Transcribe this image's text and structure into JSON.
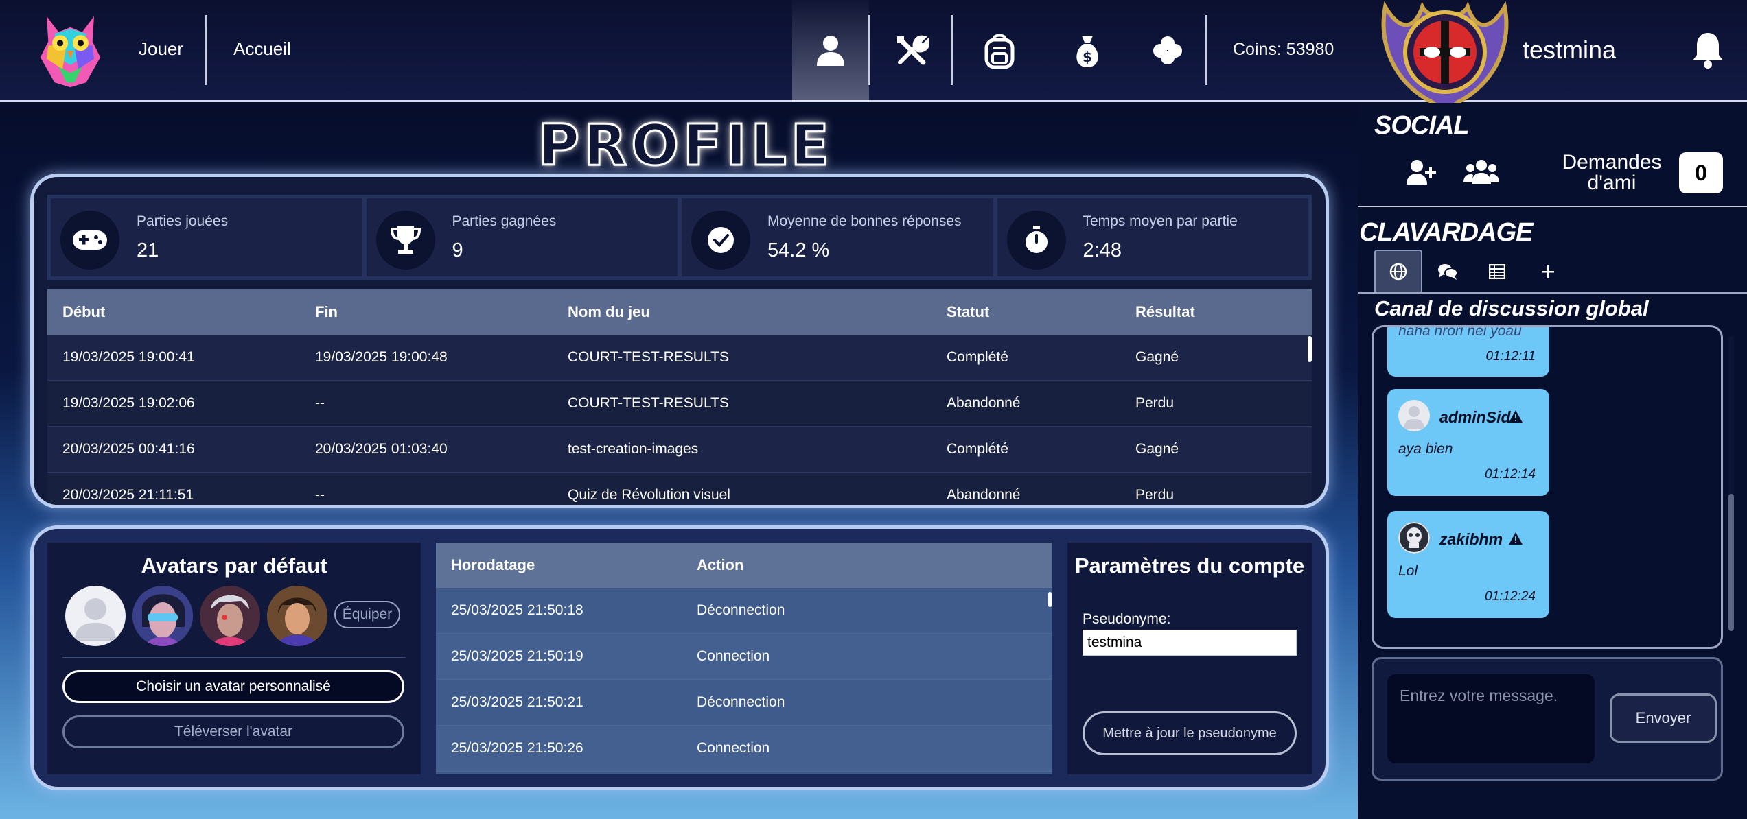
{
  "nav": {
    "play": "Jouer",
    "home": "Accueil",
    "icons": [
      "profile-icon",
      "tools-icon",
      "backpack-icon",
      "money-bag-icon",
      "clover-icon"
    ],
    "coins": "Coins: 53980",
    "username": "testmina"
  },
  "profile": {
    "title": "PROFILE",
    "stats": [
      {
        "label": "Parties jouées",
        "value": "21",
        "icon": "gamepad-icon"
      },
      {
        "label": "Parties gagnées",
        "value": "9",
        "icon": "trophy-icon"
      },
      {
        "label": "Moyenne de bonnes réponses",
        "value": "54.2 %",
        "icon": "check-circle-icon"
      },
      {
        "label": "Temps moyen par partie",
        "value": "2:48",
        "icon": "stopwatch-icon"
      }
    ],
    "games_table": {
      "headers": [
        "Début",
        "Fin",
        "Nom du jeu",
        "Statut",
        "Résultat"
      ],
      "rows": [
        [
          "19/03/2025 19:00:41",
          "19/03/2025 19:00:48",
          "COURT-TEST-RESULTS",
          "Complété",
          "Gagné"
        ],
        [
          "19/03/2025 19:02:06",
          "--",
          "COURT-TEST-RESULTS",
          "Abandonné",
          "Perdu"
        ],
        [
          "20/03/2025 00:41:16",
          "20/03/2025 01:03:40",
          "test-creation-images",
          "Complété",
          "Gagné"
        ],
        [
          "20/03/2025 21:11:51",
          "--",
          "Quiz de Révolution visuel",
          "Abandonné",
          "Perdu"
        ]
      ]
    }
  },
  "avatars": {
    "title": "Avatars par défaut",
    "equip": "Équiper",
    "choose_custom": "Choisir un avatar personnalisé",
    "upload": "Téléverser l'avatar"
  },
  "log_table": {
    "headers": [
      "Horodatage",
      "Action"
    ],
    "rows": [
      [
        "25/03/2025 21:50:18",
        "Déconnection"
      ],
      [
        "25/03/2025 21:50:19",
        "Connection"
      ],
      [
        "25/03/2025 21:50:21",
        "Déconnection"
      ],
      [
        "25/03/2025 21:50:26",
        "Connection"
      ]
    ]
  },
  "account": {
    "title": "Paramètres du compte",
    "pseudo_label": "Pseudonyme:",
    "pseudo_value": "testmina",
    "update_button": "Mettre à jour le pseudonyme"
  },
  "social": {
    "title": "SOCIAL",
    "friend_requests_label": "Demandes d'ami",
    "friend_requests_count": "0"
  },
  "chat": {
    "title": "CLAVARDAGE",
    "channel_title": "Canal de discussion global",
    "messages": [
      {
        "user": "",
        "text": "haha nrori nei yoau",
        "time": "01:12:11"
      },
      {
        "user": "adminSid",
        "text": "aya bien",
        "time": "01:12:14"
      },
      {
        "user": "zakibhm",
        "text": "Lol",
        "time": "01:12:24"
      }
    ],
    "input_placeholder": "Entrez votre message.",
    "send": "Envoyer"
  },
  "colors": {
    "accent_blue": "#6ec8f7",
    "panel_dark": "#131b3d",
    "border_glow": "#b9cdf0"
  }
}
